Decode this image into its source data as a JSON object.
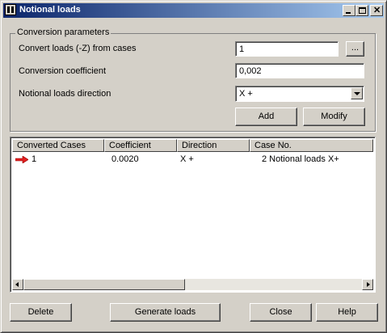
{
  "window": {
    "title": "Notional loads"
  },
  "conversion": {
    "legend": "Conversion parameters",
    "convert_label": "Convert loads (-Z) from cases",
    "convert_value": "1",
    "browse_label": "...",
    "coef_label": "Conversion coefficient",
    "coef_value": "0,002",
    "direction_label": "Notional loads direction",
    "direction_value": "X +",
    "add_label": "Add",
    "modify_label": "Modify"
  },
  "table": {
    "columns": [
      "Converted Cases",
      "Coefficient",
      "Direction",
      "Case No."
    ],
    "rows": [
      {
        "cases": "1",
        "coefficient": "0.0020",
        "direction": "X +",
        "case_no": "2 Notional loads X+"
      }
    ]
  },
  "footer": {
    "delete_label": "Delete",
    "generate_label": "Generate loads",
    "close_label": "Close",
    "help_label": "Help"
  },
  "colors": {
    "title_start": "#0a246a",
    "title_end": "#a6caf0",
    "arrow": "#e02020"
  }
}
